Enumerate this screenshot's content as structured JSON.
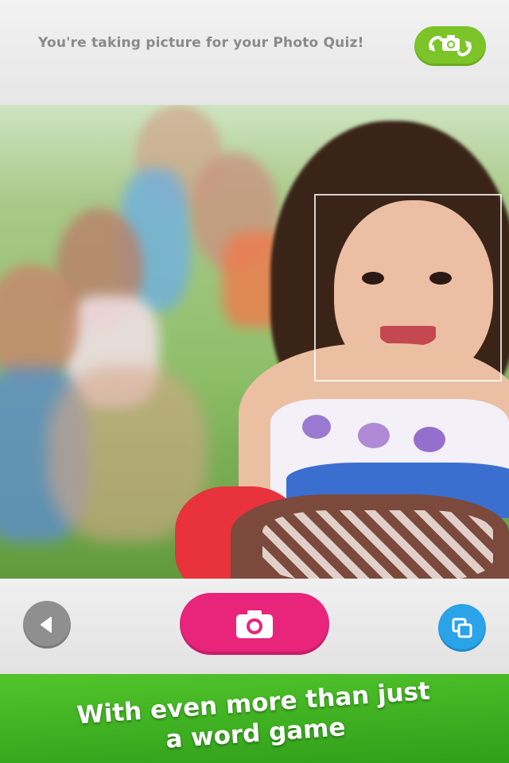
{
  "header": {
    "title": "You're taking picture for your Photo Quiz!",
    "flip_camera_icon": "camera-flip-icon"
  },
  "viewfinder": {
    "face_detection": true
  },
  "controls": {
    "back_icon": "triangle-left-icon",
    "shutter_icon": "camera-icon",
    "gallery_icon": "gallery-icon"
  },
  "banner": {
    "line1": "With even more than just",
    "line2": "a word game"
  },
  "colors": {
    "flip_button": "#7cc427",
    "shutter_button": "#e8247b",
    "gallery_button": "#2aa3e8",
    "back_button": "#8f8f8f",
    "banner": "#3fb323"
  }
}
